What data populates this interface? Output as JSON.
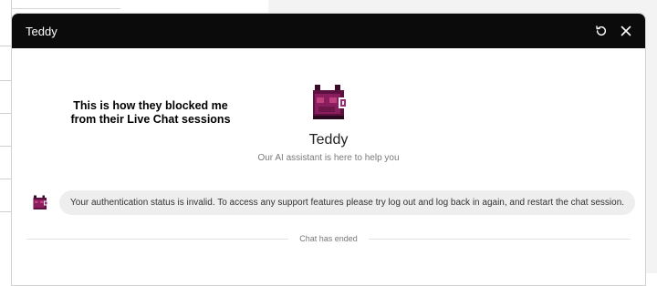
{
  "header": {
    "title": "Teddy",
    "refresh_icon": "refresh-icon",
    "close_icon": "close-icon"
  },
  "annotation": {
    "line1": "This is how they blocked me",
    "line2": "from their Live Chat sessions"
  },
  "bot": {
    "name": "Teddy",
    "subtitle": "Our AI assistant is here to help you",
    "avatar_icon": "pixel-cat-avatar"
  },
  "messages": [
    {
      "sender": "bot",
      "text": "Your authentication status is invalid. To access any support features please try log out and log back in again, and restart the chat session."
    }
  ],
  "status": {
    "ended_label": "Chat has ended"
  },
  "colors": {
    "header_bg": "#0b0b0b",
    "bubble_bg": "#eeeeee",
    "avatar_purple": "#8a1d5e"
  }
}
